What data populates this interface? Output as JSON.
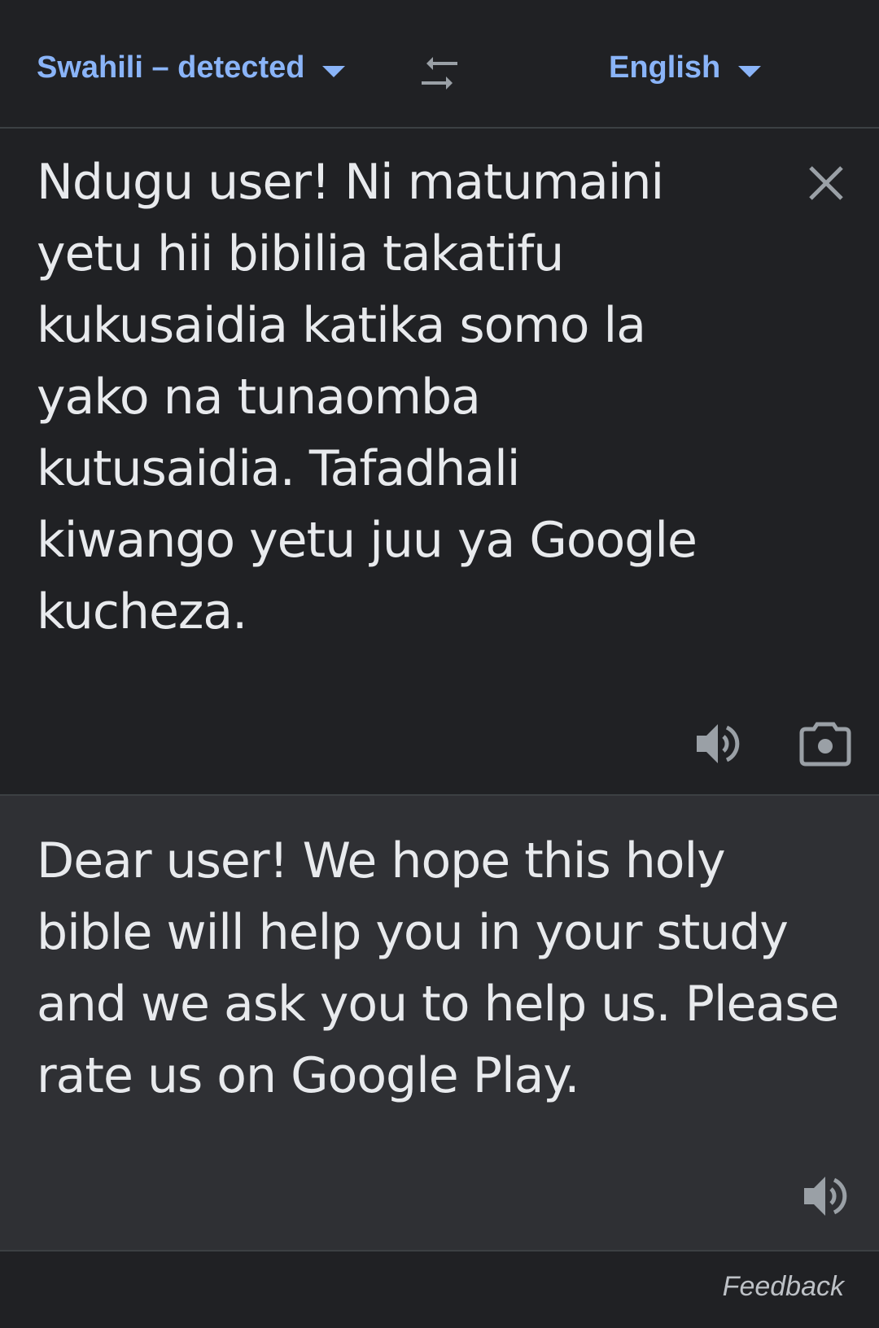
{
  "header": {
    "source_language": "Swahili – detected",
    "target_language": "English",
    "swap_icon": "swap-arrows-icon",
    "dropdown_icon": "caret-down-icon"
  },
  "source": {
    "text": "Ndugu user! Ni matumaini\nyetu hii bibilia takatifu\nkukusaidia katika somo la\nyako na tunaomba\nkutusaidia. Tafadhali\nkiwango yetu juu ya Google\nkucheza.",
    "clear_icon": "close-icon",
    "speak_icon": "volume-icon",
    "camera_icon": "camera-icon"
  },
  "translation": {
    "text": "Dear user! We hope this holy\nbible will help you in your study\nand we ask you to help us. Please\nrate us on Google Play.",
    "speak_icon": "volume-icon"
  },
  "footer": {
    "feedback_label": "Feedback"
  },
  "colors": {
    "background": "#202124",
    "translation_background": "#2f3034",
    "accent": "#8ab4f8",
    "text": "#e8eaed",
    "icon": "#9aa0a6"
  }
}
